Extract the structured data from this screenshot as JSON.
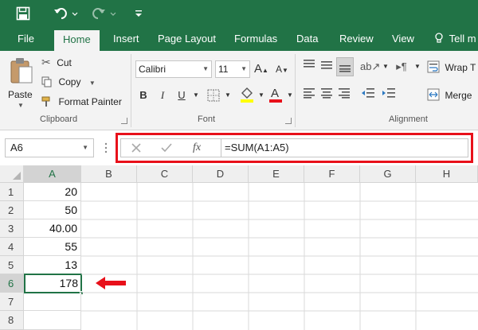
{
  "colors": {
    "accent": "#217346",
    "highlight": "#e8101a"
  },
  "quick_access": {
    "save_icon": "save-icon",
    "undo_icon": "undo-icon",
    "redo_icon": "redo-icon",
    "customize_icon": "customize-icon"
  },
  "tabs": [
    {
      "label": "File"
    },
    {
      "label": "Home"
    },
    {
      "label": "Insert"
    },
    {
      "label": "Page Layout"
    },
    {
      "label": "Formulas"
    },
    {
      "label": "Data"
    },
    {
      "label": "Review"
    },
    {
      "label": "View"
    },
    {
      "label": "Tell m"
    }
  ],
  "active_tab": "Home",
  "ribbon": {
    "clipboard": {
      "paste": "Paste",
      "cut": "Cut",
      "copy": "Copy",
      "format_painter": "Format Painter",
      "group_label": "Clipboard"
    },
    "font": {
      "name": "Calibri",
      "size": "11",
      "bold": "B",
      "italic": "I",
      "underline": "U",
      "group_label": "Font"
    },
    "alignment": {
      "wrap_text": "Wrap T",
      "merge": "Merge",
      "group_label": "Alignment"
    }
  },
  "formula_bar": {
    "name_box": "A6",
    "fx": "fx",
    "formula": "=SUM(A1:A5)"
  },
  "grid": {
    "columns": [
      "A",
      "B",
      "C",
      "D",
      "E",
      "F",
      "G",
      "H"
    ],
    "rows": [
      "1",
      "2",
      "3",
      "4",
      "5",
      "6",
      "7",
      "8"
    ],
    "column_a_values": [
      "20",
      "50",
      "40.00",
      "55",
      "13",
      "178",
      "",
      ""
    ],
    "active_cell": "A6"
  }
}
